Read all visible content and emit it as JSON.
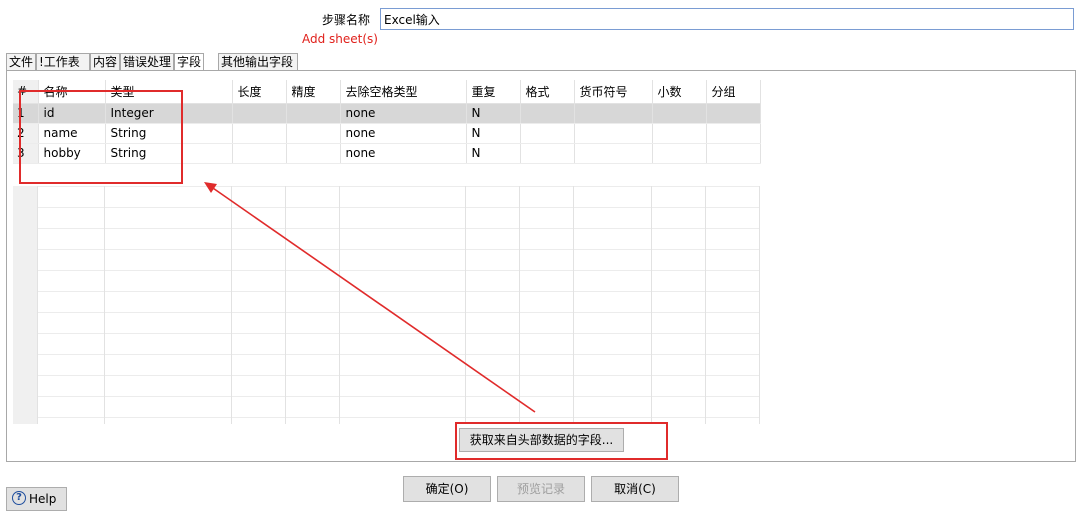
{
  "step": {
    "label": "步骤名称",
    "value": "Excel输入",
    "add_sheet_error": "Add sheet(s)"
  },
  "tabs": [
    "文件",
    "!工作表",
    "内容",
    "错误处理",
    "字段",
    "其他输出字段"
  ],
  "active_tab": "字段",
  "fields_table": {
    "columns": [
      "#",
      "名称",
      "类型",
      "长度",
      "精度",
      "去除空格类型",
      "重复",
      "格式",
      "货币符号",
      "小数",
      "分组"
    ],
    "rows": [
      [
        "1",
        "id",
        "Integer",
        "",
        "",
        "none",
        "N",
        "",
        "",
        "",
        ""
      ],
      [
        "2",
        "name",
        "String",
        "",
        "",
        "none",
        "N",
        "",
        "",
        "",
        ""
      ],
      [
        "3",
        "hobby",
        "String",
        "",
        "",
        "none",
        "N",
        "",
        "",
        "",
        ""
      ]
    ],
    "selected_row": 0,
    "sort_indicator": "^"
  },
  "buttons": {
    "get_fields": "获取来自头部数据的字段...",
    "ok": "确定(O)",
    "preview": "预览记录",
    "cancel": "取消(C)",
    "help": "Help"
  },
  "annotation_color": "#e02b2b"
}
